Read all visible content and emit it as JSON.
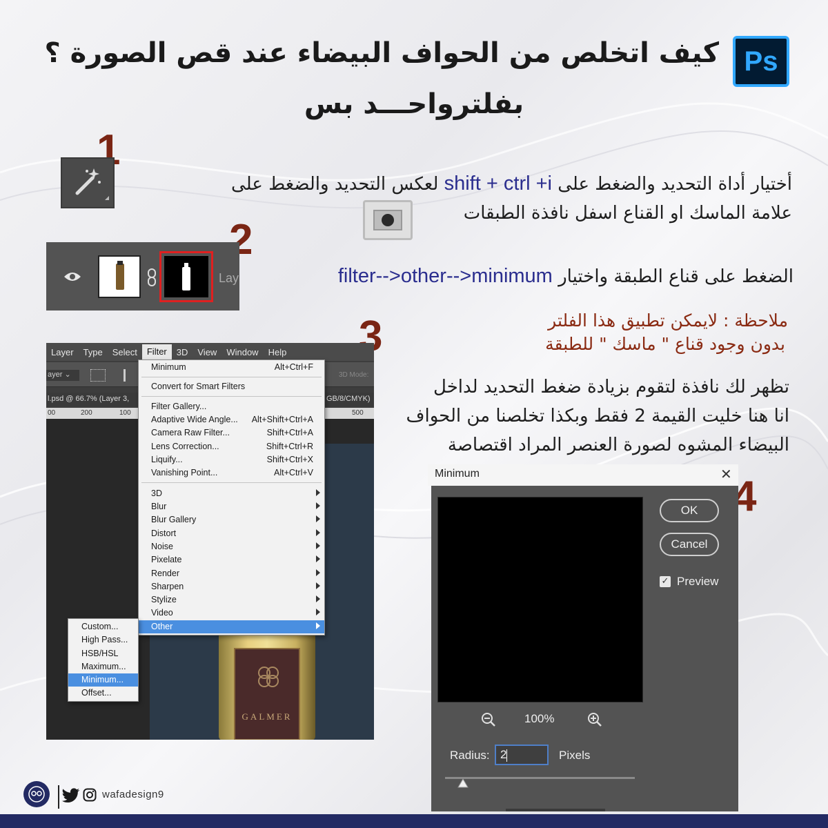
{
  "header": {
    "logo_text": "Ps",
    "title_line1": "كيف اتخلص من الحواف البيضاء عند قص الصورة ؟",
    "title_line2": "بفلترواحـــد بس"
  },
  "steps": {
    "n1": "1",
    "n2": "2",
    "n3": "3",
    "n4": "4"
  },
  "step1": {
    "line1_pre": "أختيار أداة التحديد  والضغط على ",
    "shortcut": "shift + ctrl +i",
    "line1_post": " لعكس التحديد والضغط على",
    "line2": "علامة الماسك او القناع اسفل نافذة الطبقات"
  },
  "step2": {
    "text_ar": "الضغط على قناع الطبقة واختيار ",
    "path": "filter-->other-->minimum",
    "layer_label": "Lay"
  },
  "note": {
    "line1": "ملاحظة : لايمكن تطبيق هذا الفلتر",
    "line2": "بدون وجود قناع \" ماسك \"  للطبقة"
  },
  "explain": {
    "line1": "تظهر لك نافذة لتقوم بزيادة ضغط التحديد لداخل",
    "line2": "انا هنا خليت القيمة 2 فقط وبكذا تخلصنا من الحواف",
    "line3": "البيضاء المشوه لصورة العنصر المراد اقتصاصة"
  },
  "ps_menu": {
    "menubar": [
      "Layer",
      "Type",
      "Select",
      "Filter",
      "3D",
      "View",
      "Window",
      "Help"
    ],
    "options_left": "ayer",
    "mode_label": "3D Mode:",
    "doc_tab": "l.psd @ 66.7% (Layer 3,",
    "doc_tab_right": "GB/8/CMYK)",
    "ruler_marks": [
      "00",
      "200",
      "100",
      "500"
    ],
    "filter_items": [
      {
        "label": "Minimum",
        "shortcut": "Alt+Ctrl+F"
      },
      {
        "label": "Convert for Smart Filters",
        "shortcut": ""
      },
      {
        "label": "Filter Gallery...",
        "shortcut": ""
      },
      {
        "label": "Adaptive Wide Angle...",
        "shortcut": "Alt+Shift+Ctrl+A"
      },
      {
        "label": "Camera Raw Filter...",
        "shortcut": "Shift+Ctrl+A"
      },
      {
        "label": "Lens Correction...",
        "shortcut": "Shift+Ctrl+R"
      },
      {
        "label": "Liquify...",
        "shortcut": "Shift+Ctrl+X"
      },
      {
        "label": "Vanishing Point...",
        "shortcut": "Alt+Ctrl+V"
      }
    ],
    "filter_submenus": [
      "3D",
      "Blur",
      "Blur Gallery",
      "Distort",
      "Noise",
      "Pixelate",
      "Render",
      "Sharpen",
      "Stylize",
      "Video",
      "Other"
    ],
    "other_items": [
      "Custom...",
      "High Pass...",
      "HSB/HSL",
      "Maximum...",
      "Minimum...",
      "Offset..."
    ],
    "product_label": "GALMER"
  },
  "dialog": {
    "title": "Minimum",
    "close": "✕",
    "ok": "OK",
    "cancel": "Cancel",
    "preview_label": "Preview",
    "preview_checked": true,
    "zoom": "100%",
    "radius_label": "Radius:",
    "radius_value": "2",
    "units": "Pixels"
  },
  "footer": {
    "handle": "wafadesign9"
  },
  "colors": {
    "step_number": "#7a2514",
    "shortcut_blue": "#2a2d8e",
    "note_red": "#8a2a12",
    "menu_highlight": "#4a8fe0",
    "footer_bar": "#232a63"
  }
}
